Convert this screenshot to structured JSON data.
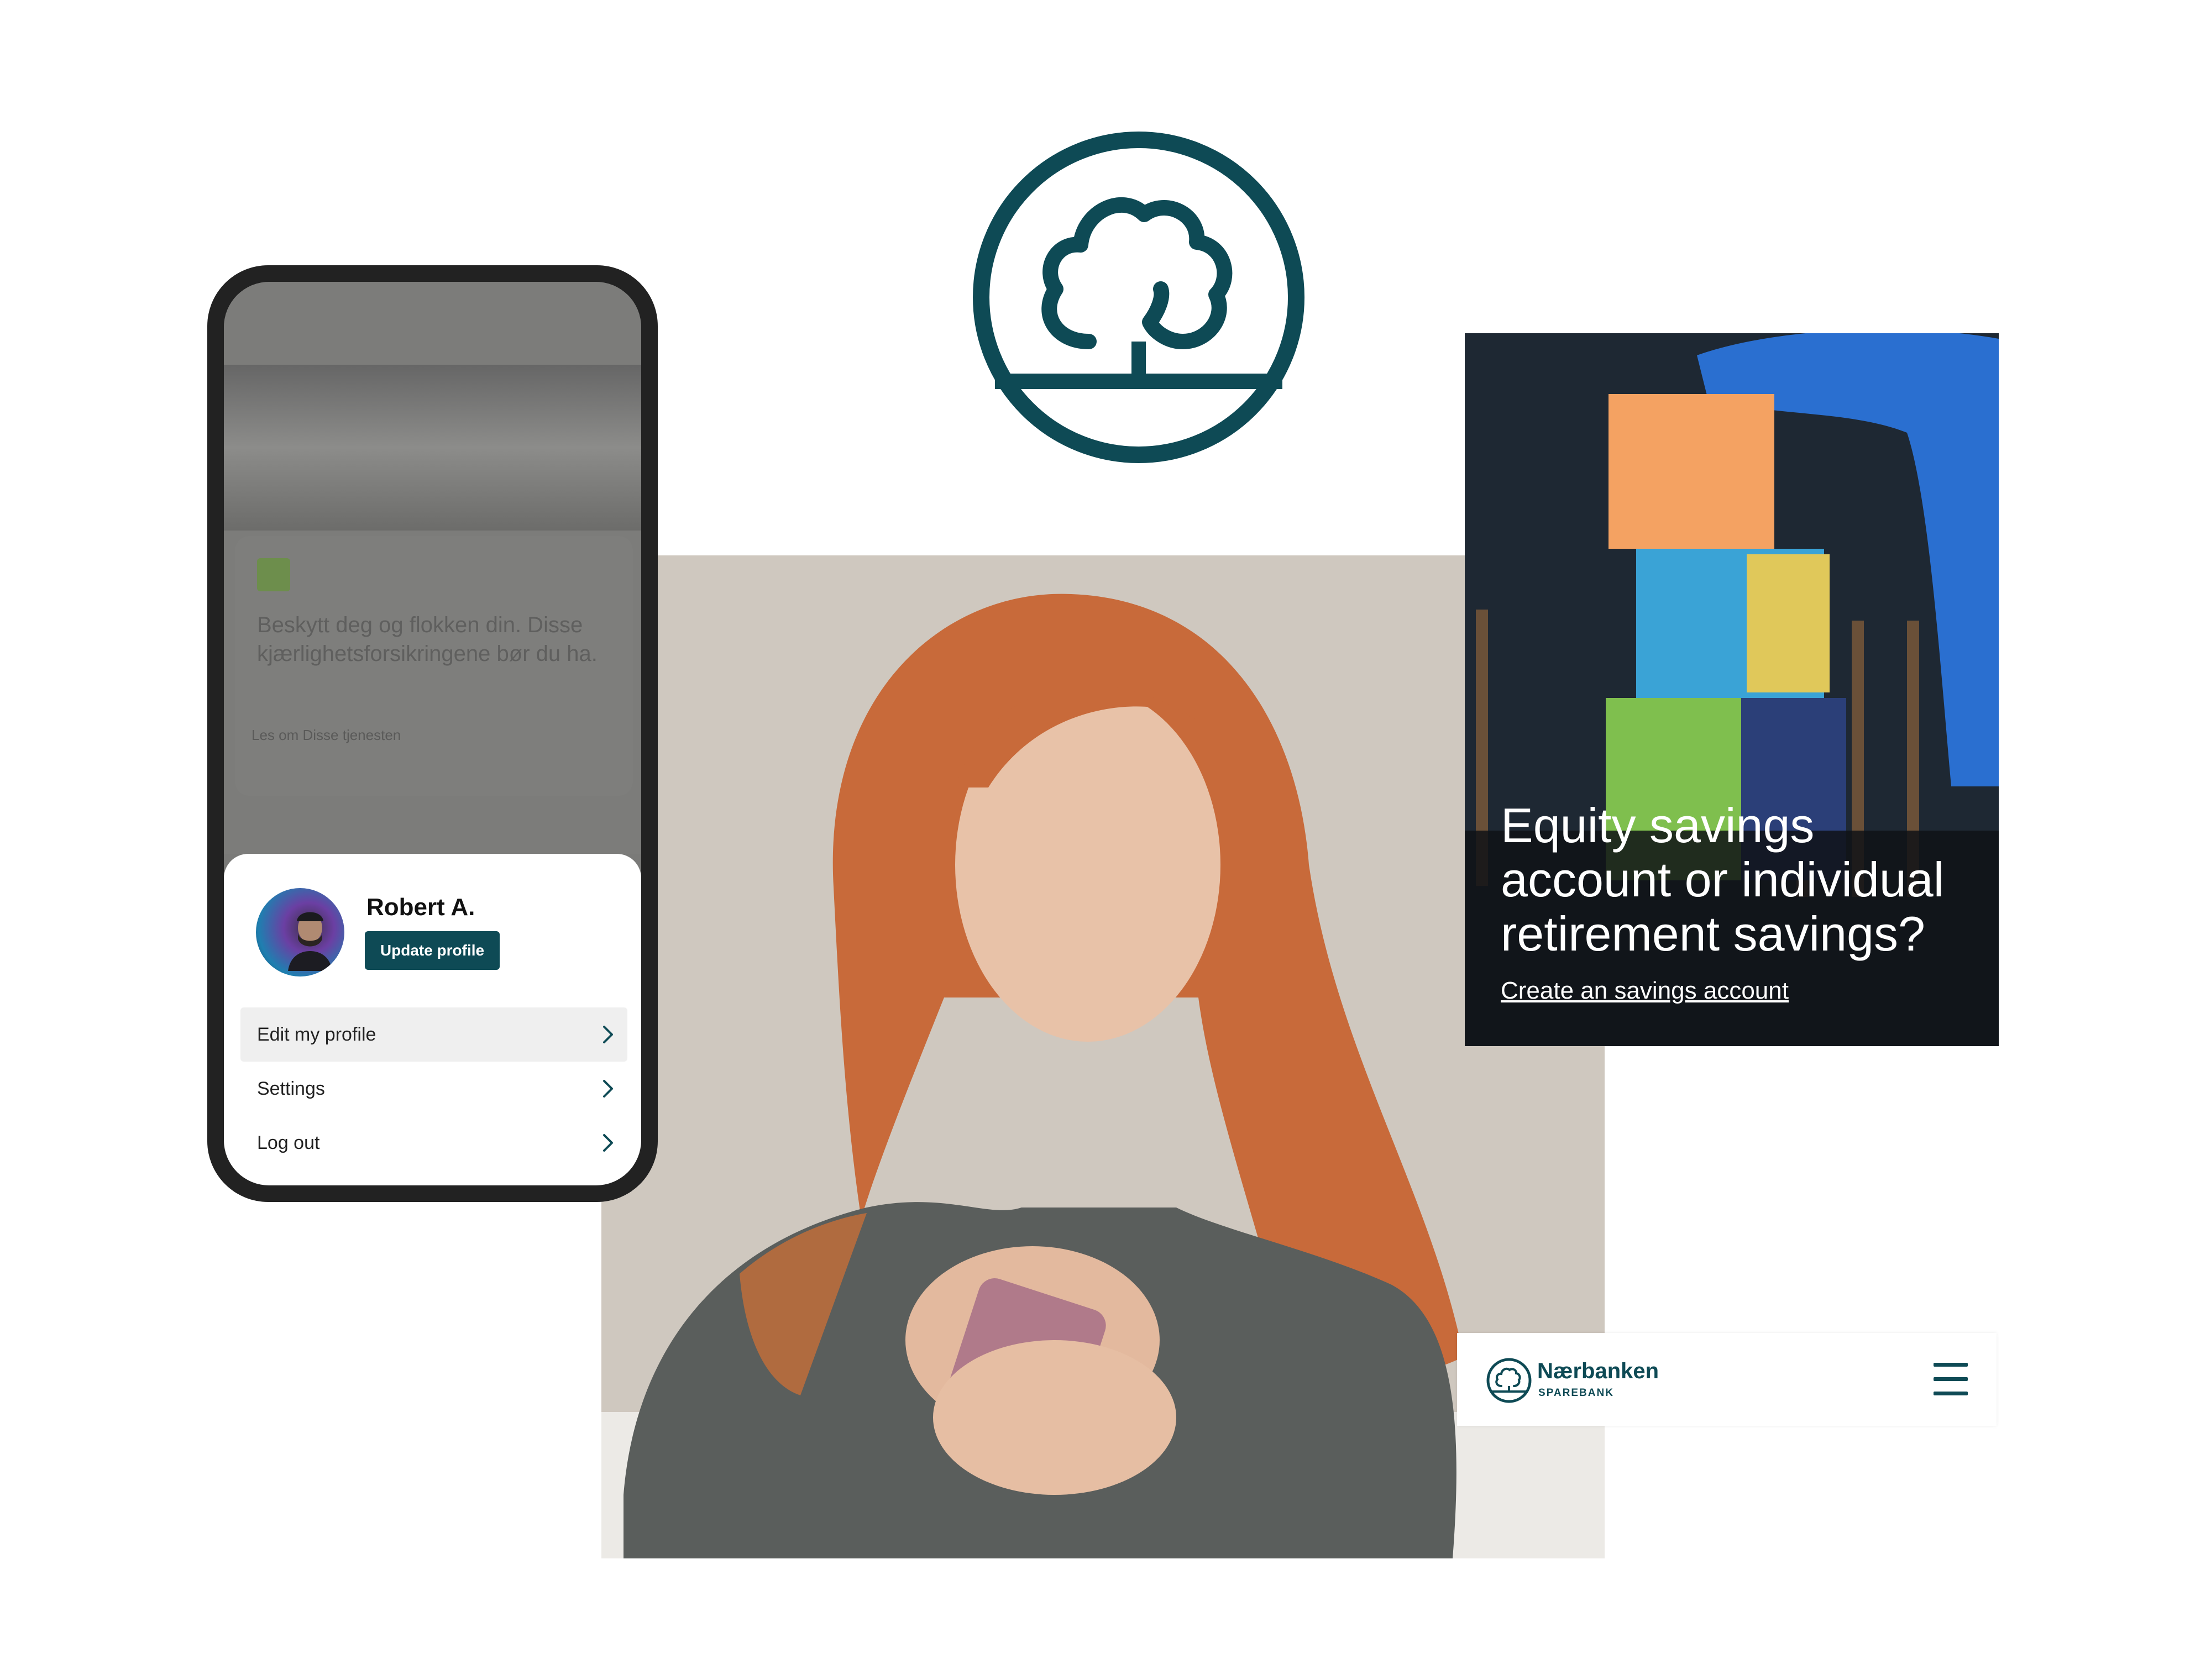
{
  "card": {
    "title": "Equity savings account or individual retirement savings?",
    "link": "Create an savings account"
  },
  "navbar": {
    "brand": "Nærbanken",
    "sub": "SPAREBANK"
  },
  "phone": {
    "blurred_card_text": "Beskytt deg og flokken din. Disse kjærlighetsforsikringene bør du ha.",
    "blurred_card_link": "Les om Disse tjenesten",
    "user_name": "Robert A.",
    "update_button": "Update profile",
    "menu": [
      {
        "label": "Edit my profile"
      },
      {
        "label": "Settings"
      },
      {
        "label": "Log out"
      }
    ]
  },
  "colors": {
    "brand_teal": "#0e4a55",
    "phone_frame": "#222222"
  },
  "icons": [
    "tree-logo-icon",
    "hamburger-menu-icon",
    "chevron-right-icon"
  ]
}
